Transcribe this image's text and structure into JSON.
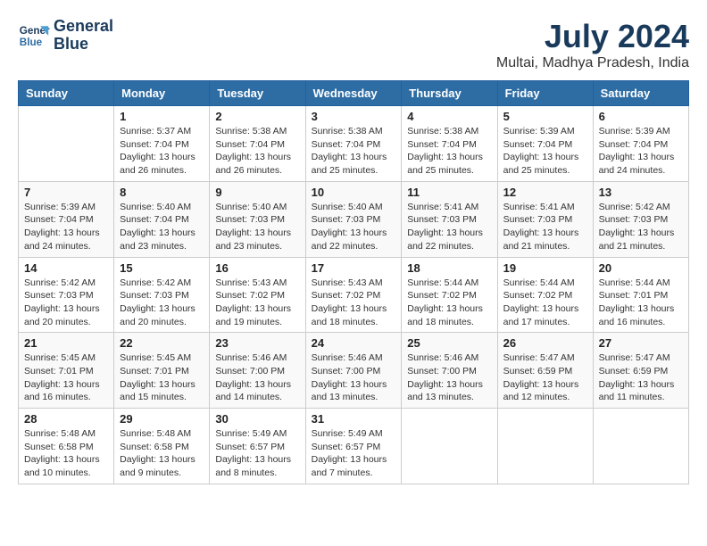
{
  "logo": {
    "line1": "General",
    "line2": "Blue"
  },
  "title": "July 2024",
  "location": "Multai, Madhya Pradesh, India",
  "weekdays": [
    "Sunday",
    "Monday",
    "Tuesday",
    "Wednesday",
    "Thursday",
    "Friday",
    "Saturday"
  ],
  "weeks": [
    [
      {
        "day": "",
        "info": ""
      },
      {
        "day": "1",
        "info": "Sunrise: 5:37 AM\nSunset: 7:04 PM\nDaylight: 13 hours\nand 26 minutes."
      },
      {
        "day": "2",
        "info": "Sunrise: 5:38 AM\nSunset: 7:04 PM\nDaylight: 13 hours\nand 26 minutes."
      },
      {
        "day": "3",
        "info": "Sunrise: 5:38 AM\nSunset: 7:04 PM\nDaylight: 13 hours\nand 25 minutes."
      },
      {
        "day": "4",
        "info": "Sunrise: 5:38 AM\nSunset: 7:04 PM\nDaylight: 13 hours\nand 25 minutes."
      },
      {
        "day": "5",
        "info": "Sunrise: 5:39 AM\nSunset: 7:04 PM\nDaylight: 13 hours\nand 25 minutes."
      },
      {
        "day": "6",
        "info": "Sunrise: 5:39 AM\nSunset: 7:04 PM\nDaylight: 13 hours\nand 24 minutes."
      }
    ],
    [
      {
        "day": "7",
        "info": "Sunrise: 5:39 AM\nSunset: 7:04 PM\nDaylight: 13 hours\nand 24 minutes."
      },
      {
        "day": "8",
        "info": "Sunrise: 5:40 AM\nSunset: 7:04 PM\nDaylight: 13 hours\nand 23 minutes."
      },
      {
        "day": "9",
        "info": "Sunrise: 5:40 AM\nSunset: 7:03 PM\nDaylight: 13 hours\nand 23 minutes."
      },
      {
        "day": "10",
        "info": "Sunrise: 5:40 AM\nSunset: 7:03 PM\nDaylight: 13 hours\nand 22 minutes."
      },
      {
        "day": "11",
        "info": "Sunrise: 5:41 AM\nSunset: 7:03 PM\nDaylight: 13 hours\nand 22 minutes."
      },
      {
        "day": "12",
        "info": "Sunrise: 5:41 AM\nSunset: 7:03 PM\nDaylight: 13 hours\nand 21 minutes."
      },
      {
        "day": "13",
        "info": "Sunrise: 5:42 AM\nSunset: 7:03 PM\nDaylight: 13 hours\nand 21 minutes."
      }
    ],
    [
      {
        "day": "14",
        "info": "Sunrise: 5:42 AM\nSunset: 7:03 PM\nDaylight: 13 hours\nand 20 minutes."
      },
      {
        "day": "15",
        "info": "Sunrise: 5:42 AM\nSunset: 7:03 PM\nDaylight: 13 hours\nand 20 minutes."
      },
      {
        "day": "16",
        "info": "Sunrise: 5:43 AM\nSunset: 7:02 PM\nDaylight: 13 hours\nand 19 minutes."
      },
      {
        "day": "17",
        "info": "Sunrise: 5:43 AM\nSunset: 7:02 PM\nDaylight: 13 hours\nand 18 minutes."
      },
      {
        "day": "18",
        "info": "Sunrise: 5:44 AM\nSunset: 7:02 PM\nDaylight: 13 hours\nand 18 minutes."
      },
      {
        "day": "19",
        "info": "Sunrise: 5:44 AM\nSunset: 7:02 PM\nDaylight: 13 hours\nand 17 minutes."
      },
      {
        "day": "20",
        "info": "Sunrise: 5:44 AM\nSunset: 7:01 PM\nDaylight: 13 hours\nand 16 minutes."
      }
    ],
    [
      {
        "day": "21",
        "info": "Sunrise: 5:45 AM\nSunset: 7:01 PM\nDaylight: 13 hours\nand 16 minutes."
      },
      {
        "day": "22",
        "info": "Sunrise: 5:45 AM\nSunset: 7:01 PM\nDaylight: 13 hours\nand 15 minutes."
      },
      {
        "day": "23",
        "info": "Sunrise: 5:46 AM\nSunset: 7:00 PM\nDaylight: 13 hours\nand 14 minutes."
      },
      {
        "day": "24",
        "info": "Sunrise: 5:46 AM\nSunset: 7:00 PM\nDaylight: 13 hours\nand 13 minutes."
      },
      {
        "day": "25",
        "info": "Sunrise: 5:46 AM\nSunset: 7:00 PM\nDaylight: 13 hours\nand 13 minutes."
      },
      {
        "day": "26",
        "info": "Sunrise: 5:47 AM\nSunset: 6:59 PM\nDaylight: 13 hours\nand 12 minutes."
      },
      {
        "day": "27",
        "info": "Sunrise: 5:47 AM\nSunset: 6:59 PM\nDaylight: 13 hours\nand 11 minutes."
      }
    ],
    [
      {
        "day": "28",
        "info": "Sunrise: 5:48 AM\nSunset: 6:58 PM\nDaylight: 13 hours\nand 10 minutes."
      },
      {
        "day": "29",
        "info": "Sunrise: 5:48 AM\nSunset: 6:58 PM\nDaylight: 13 hours\nand 9 minutes."
      },
      {
        "day": "30",
        "info": "Sunrise: 5:49 AM\nSunset: 6:57 PM\nDaylight: 13 hours\nand 8 minutes."
      },
      {
        "day": "31",
        "info": "Sunrise: 5:49 AM\nSunset: 6:57 PM\nDaylight: 13 hours\nand 7 minutes."
      },
      {
        "day": "",
        "info": ""
      },
      {
        "day": "",
        "info": ""
      },
      {
        "day": "",
        "info": ""
      }
    ]
  ]
}
